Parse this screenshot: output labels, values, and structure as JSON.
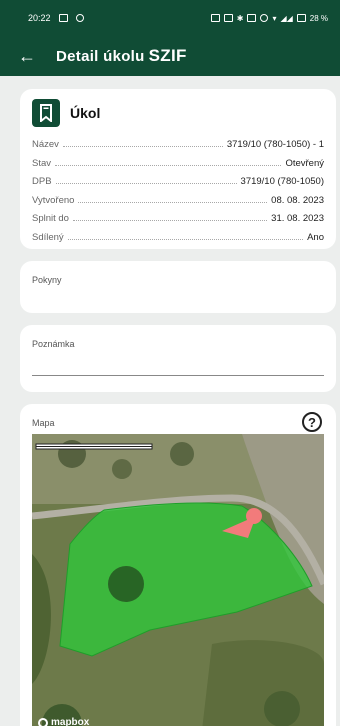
{
  "status_bar": {
    "time": "20:22",
    "battery": "28 %"
  },
  "header": {
    "back_icon": "arrow-left-icon",
    "title": "Detail úkolu",
    "title_strong": "SZIF"
  },
  "task": {
    "icon": "bookmark-icon",
    "title": "Úkol",
    "rows": [
      {
        "label": "Název",
        "value": "3719/10 (780-1050) - 1"
      },
      {
        "label": "Stav",
        "value": "Otevřený"
      },
      {
        "label": "DPB",
        "value": "3719/10 (780-1050)"
      },
      {
        "label": "Vytvořeno",
        "value": "08. 08. 2023"
      },
      {
        "label": "Splnit do",
        "value": "31. 08. 2023"
      },
      {
        "label": "Sdílený",
        "value": "Ano"
      }
    ]
  },
  "pokyny": {
    "label": "Pokyny"
  },
  "poznamka": {
    "label": "Poznámka",
    "value": ""
  },
  "mapa": {
    "label": "Mapa",
    "help_icon": "help-circle-icon",
    "help_glyph": "?",
    "attribution": "mapbox",
    "colors": {
      "parcel_fill": "#2ec83a",
      "marker": "#f27b7b"
    }
  },
  "colors": {
    "primary": "#104c35",
    "background": "#eceeed"
  }
}
